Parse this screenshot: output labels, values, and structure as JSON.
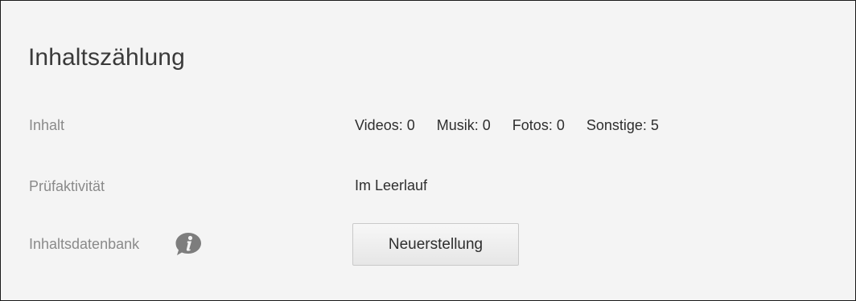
{
  "section": {
    "title": "Inhaltszählung"
  },
  "rows": {
    "content": {
      "label": "Inhalt",
      "counts": [
        "Videos: 0",
        "Musik: 0",
        "Fotos: 0",
        "Sonstige: 5"
      ]
    },
    "scan": {
      "label": "Prüfaktivität",
      "value": "Im Leerlauf"
    },
    "database": {
      "label": "Inhaltsdatenbank",
      "icon": "info-icon",
      "button_label": "Neuerstellung"
    }
  },
  "colors": {
    "panel_bg": "#f4f4f4",
    "label": "#8a8a8a",
    "value": "#2e2e2e",
    "icon": "#7d7d7d"
  }
}
